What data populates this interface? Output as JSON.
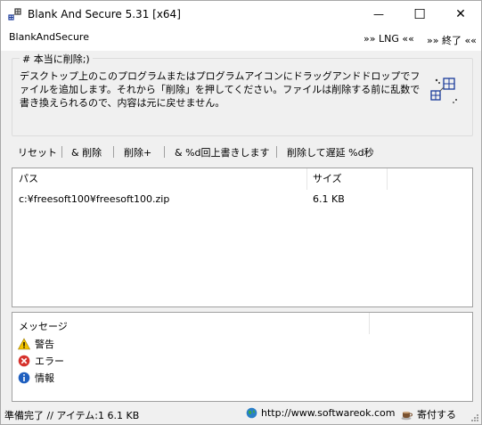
{
  "window": {
    "title": "Blank And Secure 5.31 [x64]",
    "minimize_glyph": "—",
    "maximize_glyph": "☐",
    "close_glyph": "✕"
  },
  "menu": {
    "app_label": "BlankAndSecure",
    "lng_label": "»» LNG ««",
    "exit_label": "»» 終了 ««"
  },
  "info_group": {
    "legend": "# 本当に削除;)",
    "text": "デスクトップ上のこのプログラムまたはプログラムアイコンにドラッグアンドドロップでファイルを追加します。それから「削除」を押してください。ファイルは削除する前に乱数で書き換えられるので、内容は元に戻せません。"
  },
  "toolbar": {
    "reset": "リセット",
    "and_delete": "& 削除",
    "delete_plus": "削除+",
    "overwrite_n": "& %d回上書きします",
    "delete_delay": "削除して遅延 %d秒"
  },
  "file_list": {
    "columns": [
      "パス",
      "サイズ"
    ],
    "rows": [
      {
        "path": "c:¥freesoft100¥freesoft100.zip",
        "size": "6.1 KB"
      }
    ]
  },
  "messages": {
    "header": "メッセージ",
    "items": [
      {
        "label": "警告",
        "icon": "warning-icon"
      },
      {
        "label": "エラー",
        "icon": "error-icon"
      },
      {
        "label": "情報",
        "icon": "info-icon"
      }
    ]
  },
  "status": {
    "text": "準備完了 // アイテム:1 6.1 KB",
    "website": "http://www.softwareok.com",
    "donate": "寄付する"
  },
  "colors": {
    "warning": "#f2c200",
    "error": "#d6322c",
    "info": "#1f5fbf",
    "globe": "#2a7fc9"
  }
}
